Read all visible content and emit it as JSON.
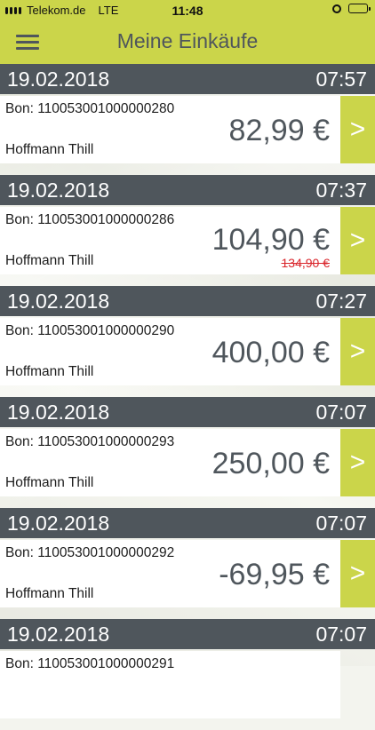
{
  "status_bar": {
    "carrier": "Telekom.de",
    "network": "LTE",
    "time": "11:48"
  },
  "header": {
    "title": "Meine Einkäufe"
  },
  "purchases": [
    {
      "date": "19.02.2018",
      "time": "07:57",
      "bon": "Bon: 110053001000000280",
      "amount": "82,99 €",
      "customer": "Hoffmann Thill",
      "arrow": ">"
    },
    {
      "date": "19.02.2018",
      "time": "07:37",
      "bon": "Bon: 110053001000000286",
      "amount": "104,90 €",
      "old_amount": "134,90 €",
      "customer": "Hoffmann Thill",
      "arrow": ">"
    },
    {
      "date": "19.02.2018",
      "time": "07:27",
      "bon": "Bon: 110053001000000290",
      "amount": "400,00 €",
      "customer": "Hoffmann Thill",
      "arrow": ">"
    },
    {
      "date": "19.02.2018",
      "time": "07:07",
      "bon": "Bon: 110053001000000293",
      "amount": "250,00 €",
      "customer": "Hoffmann Thill",
      "arrow": ">"
    },
    {
      "date": "19.02.2018",
      "time": "07:07",
      "bon": "Bon: 110053001000000292",
      "amount": "-69,95 €",
      "customer": "Hoffmann Thill",
      "arrow": ">"
    },
    {
      "date": "19.02.2018",
      "time": "07:07",
      "bon": "Bon: 110053001000000291"
    }
  ],
  "colors": {
    "accent": "#cbd54a",
    "dark": "#4f565c",
    "strike_price": "#d9262c"
  },
  "icons": [
    "signal-icon",
    "alarm-icon",
    "battery-icon",
    "menu-icon",
    "chevron-right-icon"
  ]
}
